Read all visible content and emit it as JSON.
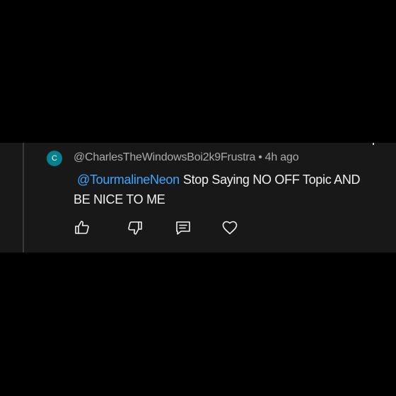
{
  "comment": {
    "avatar_initial": "C",
    "author": "@CharlesTheWindowsBoi2k9Frustra",
    "separator": "•",
    "timestamp": "4h ago",
    "mention": "@TourmalineNeon",
    "text": "Stop Saying NO OFF Topic AND BE NICE TO ME"
  },
  "actions": [
    {
      "icon": "thumbs-up-icon"
    },
    {
      "icon": "thumbs-down-icon"
    },
    {
      "icon": "reply-icon"
    },
    {
      "icon": "heart-icon"
    }
  ],
  "colors": {
    "background": "#000000",
    "panel": "#181818",
    "avatar": "#00838f",
    "mention": "#3ea6ff",
    "text": "#f1f1f1",
    "meta": "#aaaaaa"
  }
}
